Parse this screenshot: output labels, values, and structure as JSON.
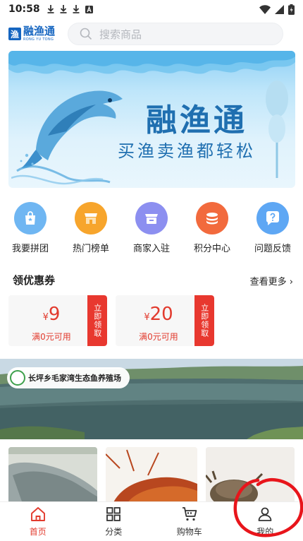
{
  "status_bar": {
    "time": "10:58",
    "notif_icons": [
      "download-icon",
      "download-icon",
      "download-icon",
      "a-icon"
    ],
    "right_icons": [
      "wifi-icon",
      "signal-icon",
      "battery-icon"
    ]
  },
  "header": {
    "logo": {
      "badge": "渔",
      "name": "融渔通",
      "english": "RONG YU TONG"
    },
    "search": {
      "placeholder": "搜索商品",
      "icon": "search-icon"
    }
  },
  "banner": {
    "title": "融渔通",
    "subtitle": "买渔卖渔都轻松"
  },
  "categories": [
    {
      "label": "我要拼团",
      "icon": "bag-icon",
      "color": "#6fb6f2"
    },
    {
      "label": "热门榜单",
      "icon": "store-icon",
      "color": "#f7a52c"
    },
    {
      "label": "商家入驻",
      "icon": "shop-icon",
      "color": "#8c8ff0"
    },
    {
      "label": "积分中心",
      "icon": "coins-icon",
      "color": "#f26a3d"
    },
    {
      "label": "问题反馈",
      "icon": "question-icon",
      "color": "#5ea7f4"
    }
  ],
  "coupons_section": {
    "title": "领优惠券",
    "more": "查看更多 ›",
    "coupons": [
      {
        "currency": "¥",
        "amount": "9",
        "condition": "满0元可用",
        "button": "立即领取"
      },
      {
        "currency": "¥",
        "amount": "20",
        "condition": "满0元可用",
        "button": "立即领取"
      }
    ]
  },
  "farm": {
    "name": "长坪乡毛家湾生态鱼养殖场"
  },
  "tabbar": {
    "tabs": [
      {
        "label": "首页",
        "icon": "home-icon",
        "active": true
      },
      {
        "label": "分类",
        "icon": "grid-icon",
        "active": false
      },
      {
        "label": "购物车",
        "icon": "cart-icon",
        "active": false
      },
      {
        "label": "我的",
        "icon": "user-icon",
        "active": false
      }
    ]
  },
  "colors": {
    "accent": "#e23b2e",
    "brand": "#1565c0"
  }
}
